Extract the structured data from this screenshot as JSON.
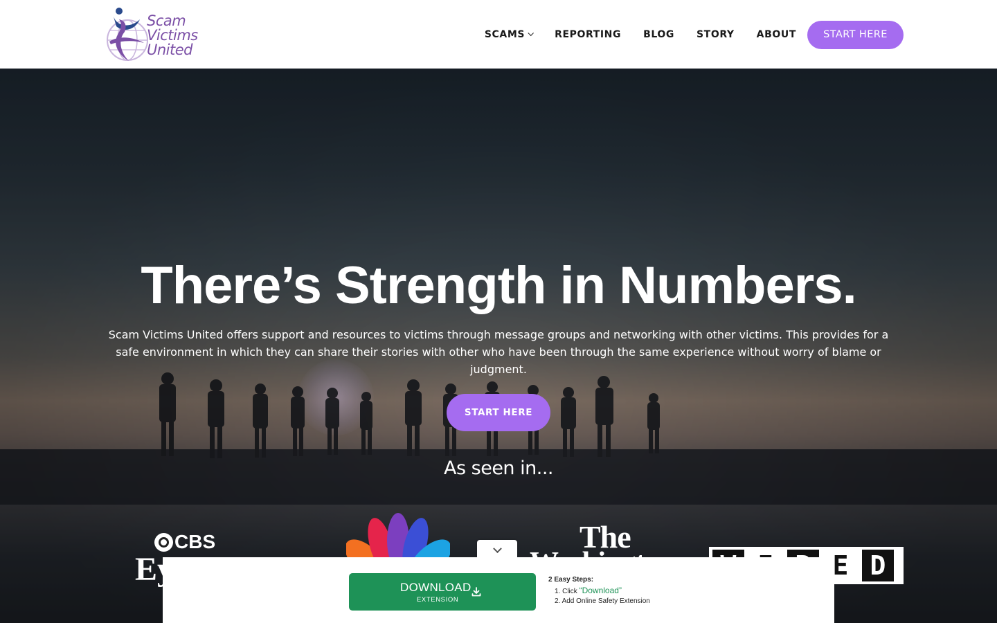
{
  "header": {
    "logo_text": [
      "Scam",
      "Victims",
      "United"
    ],
    "nav": [
      {
        "label": "SCAMS",
        "has_dropdown": true
      },
      {
        "label": "REPORTING",
        "has_dropdown": false
      },
      {
        "label": "BLOG",
        "has_dropdown": false
      },
      {
        "label": "STORY",
        "has_dropdown": false
      },
      {
        "label": "ABOUT",
        "has_dropdown": false
      }
    ],
    "cta": "START HERE"
  },
  "hero": {
    "title": "There’s Strength in Numbers.",
    "subtitle": "Scam Victims United offers support and resources to victims through message groups and networking with other victims. This provides for a safe environment in which they can share their stories with other who have been through the same experience without worry of blame or judgment.",
    "cta": "START HERE",
    "seen_in": "As seen in..."
  },
  "press": {
    "cbs_top": "CBS",
    "cbs_bottom": "Ey",
    "wapo_the": "The",
    "wapo_main": "Washington",
    "wired_letters": [
      "W",
      "I",
      "R",
      "E",
      "D"
    ]
  },
  "extension": {
    "download_label": "DOWNLOAD",
    "download_sublabel": "EXTENSION",
    "steps_title": "2 Easy Steps:",
    "step1_prefix": "1. Click",
    "step1_highlight": "“Download”",
    "step2": "2. Add Online Safety Extension"
  },
  "colors": {
    "accent_purple": "#a56cf0",
    "logo_purple": "#7b4fa6",
    "logo_blue": "#2a4a8c",
    "download_green": "#1e9257"
  }
}
